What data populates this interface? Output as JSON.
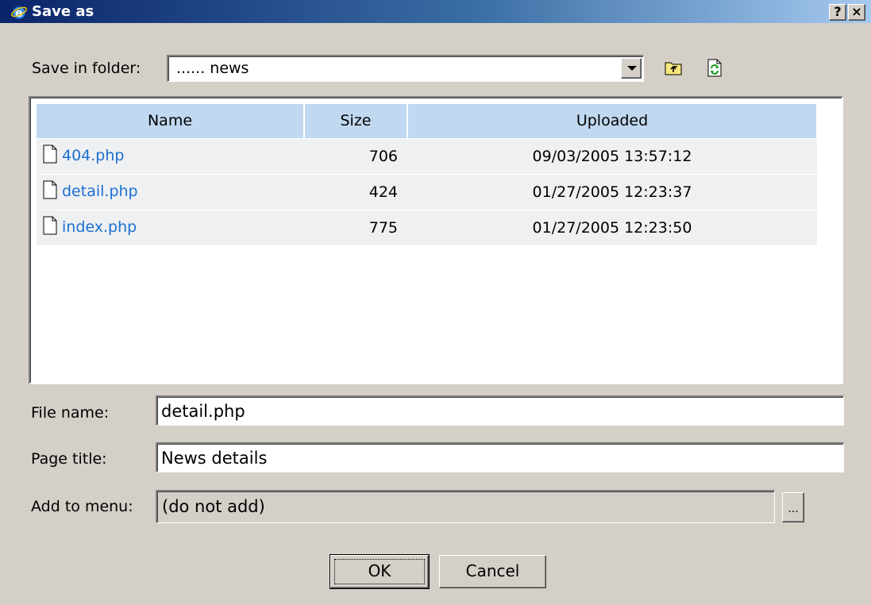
{
  "window": {
    "title": "Save as",
    "help_label": "?",
    "close_label": "×"
  },
  "folder": {
    "label": "Save in folder:",
    "value": "...... news"
  },
  "file_list": {
    "columns": [
      "Name",
      "Size",
      "Uploaded"
    ],
    "rows": [
      {
        "name": "404.php",
        "size": "706",
        "uploaded": "09/03/2005 13:57:12"
      },
      {
        "name": "detail.php",
        "size": "424",
        "uploaded": "01/27/2005 12:23:37"
      },
      {
        "name": "index.php",
        "size": "775",
        "uploaded": "01/27/2005 12:23:50"
      }
    ]
  },
  "form": {
    "file_name_label": "File name:",
    "file_name_value": "detail.php",
    "page_title_label": "Page title:",
    "page_title_value": "News details",
    "add_to_menu_label": "Add to menu:",
    "add_to_menu_value": "(do not add)",
    "browse_label": "..."
  },
  "buttons": {
    "ok": "OK",
    "cancel": "Cancel"
  },
  "colors": {
    "titlebar_start": "#0a246a",
    "titlebar_end": "#a6caf0",
    "header_bg": "#c0d8f0",
    "link": "#1d6fd0",
    "dialog_bg": "#d4d0c8"
  },
  "icons": {
    "title": "ie-logo-icon",
    "up_folder": "folder-up-icon",
    "refresh": "refresh-icon",
    "file": "document-icon"
  }
}
